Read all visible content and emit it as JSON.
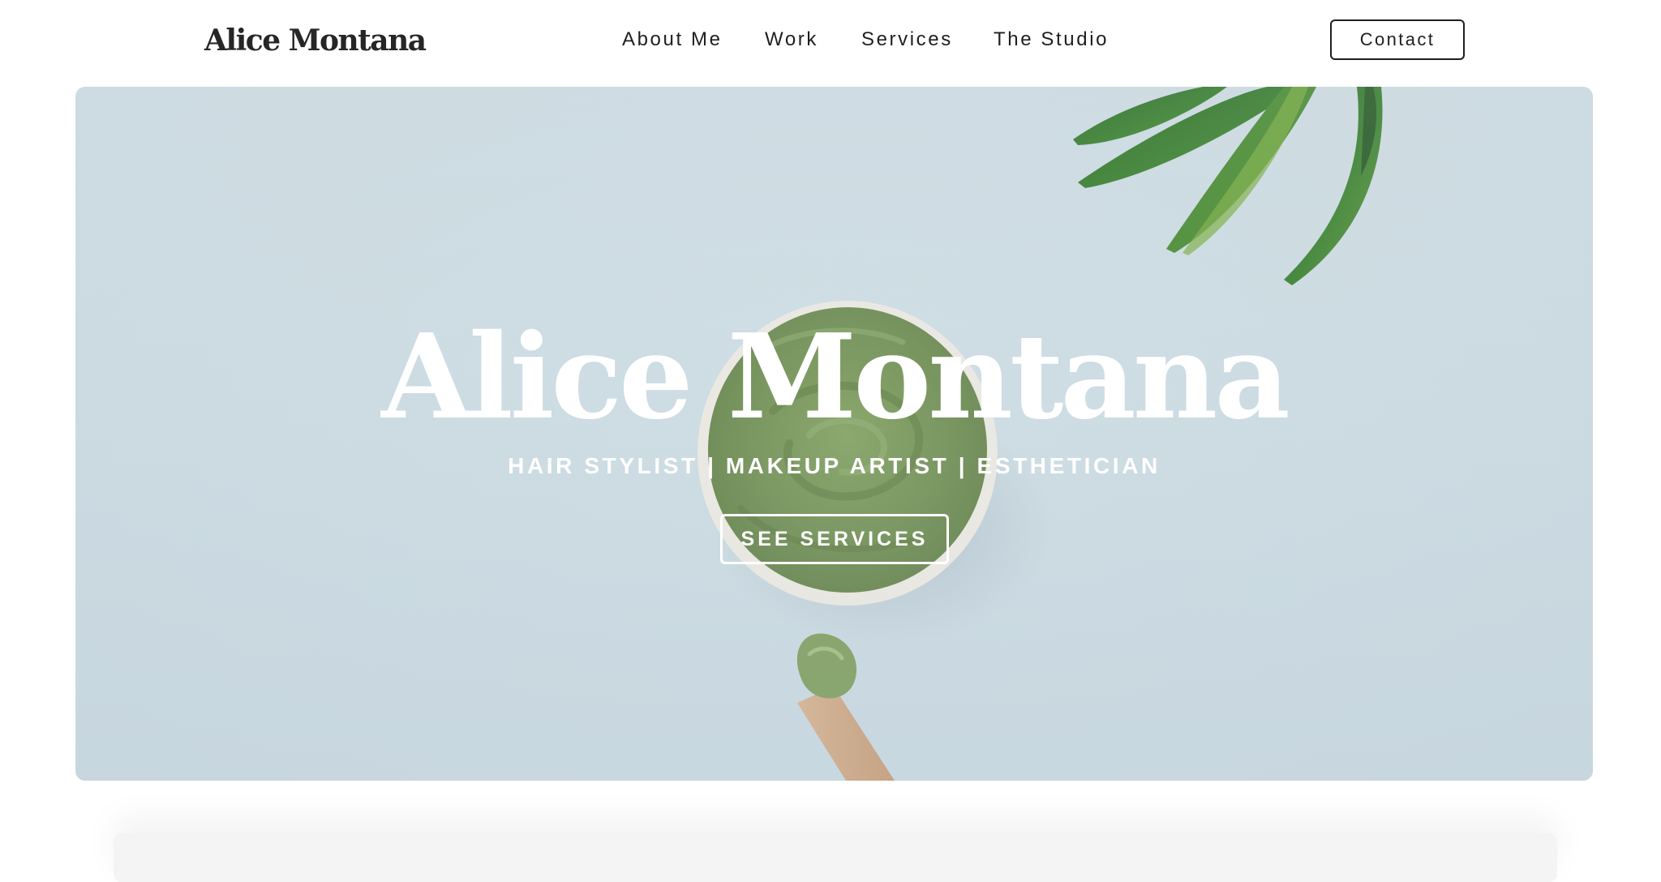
{
  "header": {
    "logo": "Alice Montana",
    "nav": {
      "about": "About Me",
      "work": "Work",
      "services": "Services",
      "studio": "The Studio"
    },
    "contact_label": "Contact"
  },
  "hero": {
    "title": "Alice Montana",
    "subtitle": "HAIR STYLIST | MAKEUP ARTIST | ESTHETICIAN",
    "cta_label": "SEE SERVICES",
    "background": "green clay mask bowl with leaves and brush on pale blue surface"
  },
  "colors": {
    "text_dark": "#1f1f1f",
    "hero_background": "#cfdde4",
    "clay_green": "#7e9a62",
    "leaf_green": "#3f7a34",
    "white": "#ffffff"
  }
}
